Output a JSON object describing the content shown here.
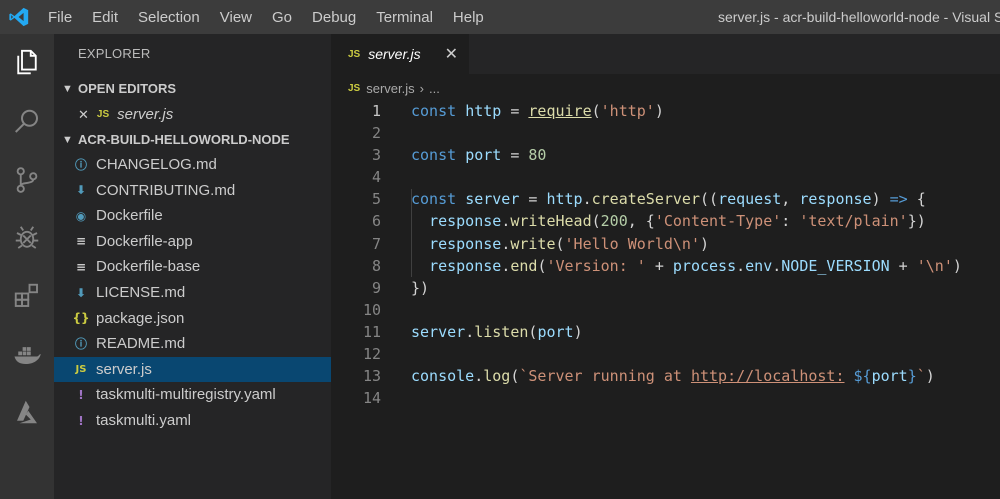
{
  "titlebar": {
    "menu": [
      "File",
      "Edit",
      "Selection",
      "View",
      "Go",
      "Debug",
      "Terminal",
      "Help"
    ],
    "window_title": "server.js - acr-build-helloworld-node - Visual S"
  },
  "activity_bar": {
    "icons": [
      "explorer-icon",
      "search-icon",
      "source-control-icon",
      "debug-icon",
      "extensions-icon",
      "docker-icon",
      "azure-icon"
    ]
  },
  "sidebar": {
    "title": "EXPLORER",
    "open_editors": {
      "label": "OPEN EDITORS",
      "items": [
        {
          "close": "✕",
          "type_badge": "JS",
          "name": "server.js"
        }
      ]
    },
    "project": {
      "label": "ACR-BUILD-HELLOWORLD-NODE",
      "files": [
        {
          "icon": "info-icon",
          "glyph": "ⓘ",
          "name": "CHANGELOG.md"
        },
        {
          "icon": "markdown-icon",
          "glyph": "⬇",
          "name": "CONTRIBUTING.md"
        },
        {
          "icon": "docker-file-icon",
          "glyph": "◉",
          "name": "Dockerfile"
        },
        {
          "icon": "text-file-icon",
          "glyph": "≡",
          "name": "Dockerfile-app"
        },
        {
          "icon": "text-file-icon",
          "glyph": "≡",
          "name": "Dockerfile-base"
        },
        {
          "icon": "markdown-icon",
          "glyph": "⬇",
          "name": "LICENSE.md"
        },
        {
          "icon": "json-icon",
          "glyph": "{}",
          "name": "package.json"
        },
        {
          "icon": "info-icon",
          "glyph": "ⓘ",
          "name": "README.md"
        },
        {
          "icon": "javascript-icon",
          "glyph": "JS",
          "name": "server.js"
        },
        {
          "icon": "yaml-icon",
          "glyph": "!",
          "name": "taskmulti-multiregistry.yaml"
        },
        {
          "icon": "yaml-icon",
          "glyph": "!",
          "name": "taskmulti.yaml"
        }
      ],
      "selected": "server.js"
    }
  },
  "editor": {
    "tab": {
      "type_badge": "JS",
      "label": "server.js",
      "close": "✕"
    },
    "breadcrumb": {
      "type_badge": "JS",
      "file": "server.js",
      "separator": "›",
      "more": "..."
    },
    "active_line": 1,
    "lines": [
      [
        {
          "t": "const",
          "c": "k"
        },
        {
          "t": " "
        },
        {
          "t": "http",
          "c": "v"
        },
        {
          "t": " = "
        },
        {
          "t": "require",
          "c": "f u"
        },
        {
          "t": "("
        },
        {
          "t": "'http'",
          "c": "s"
        },
        {
          "t": ")"
        }
      ],
      [],
      [
        {
          "t": "const",
          "c": "k"
        },
        {
          "t": " "
        },
        {
          "t": "port",
          "c": "v"
        },
        {
          "t": " = "
        },
        {
          "t": "80",
          "c": "n"
        }
      ],
      [],
      [
        {
          "t": "const",
          "c": "k"
        },
        {
          "t": " "
        },
        {
          "t": "server",
          "c": "v"
        },
        {
          "t": " = "
        },
        {
          "t": "http",
          "c": "v"
        },
        {
          "t": "."
        },
        {
          "t": "createServer",
          "c": "f"
        },
        {
          "t": "(("
        },
        {
          "t": "request",
          "c": "v"
        },
        {
          "t": ", "
        },
        {
          "t": "response",
          "c": "v"
        },
        {
          "t": ") "
        },
        {
          "t": "=>",
          "c": "k"
        },
        {
          "t": " {"
        }
      ],
      [
        {
          "t": "  "
        },
        {
          "t": "response",
          "c": "v"
        },
        {
          "t": "."
        },
        {
          "t": "writeHead",
          "c": "f"
        },
        {
          "t": "("
        },
        {
          "t": "200",
          "c": "n"
        },
        {
          "t": ", {"
        },
        {
          "t": "'Content-Type'",
          "c": "s"
        },
        {
          "t": ": "
        },
        {
          "t": "'text/plain'",
          "c": "s"
        },
        {
          "t": "})"
        }
      ],
      [
        {
          "t": "  "
        },
        {
          "t": "response",
          "c": "v"
        },
        {
          "t": "."
        },
        {
          "t": "write",
          "c": "f"
        },
        {
          "t": "("
        },
        {
          "t": "'Hello World\\n'",
          "c": "s"
        },
        {
          "t": ")"
        }
      ],
      [
        {
          "t": "  "
        },
        {
          "t": "response",
          "c": "v"
        },
        {
          "t": "."
        },
        {
          "t": "end",
          "c": "f"
        },
        {
          "t": "("
        },
        {
          "t": "'Version: '",
          "c": "s"
        },
        {
          "t": " + "
        },
        {
          "t": "process",
          "c": "v"
        },
        {
          "t": "."
        },
        {
          "t": "env",
          "c": "v"
        },
        {
          "t": "."
        },
        {
          "t": "NODE_VERSION",
          "c": "v"
        },
        {
          "t": " + "
        },
        {
          "t": "'\\n'",
          "c": "s"
        },
        {
          "t": ")"
        }
      ],
      [
        {
          "t": "})"
        }
      ],
      [],
      [
        {
          "t": "server",
          "c": "v"
        },
        {
          "t": "."
        },
        {
          "t": "listen",
          "c": "f"
        },
        {
          "t": "("
        },
        {
          "t": "port",
          "c": "v"
        },
        {
          "t": ")"
        }
      ],
      [],
      [
        {
          "t": "console",
          "c": "v"
        },
        {
          "t": "."
        },
        {
          "t": "log",
          "c": "f"
        },
        {
          "t": "("
        },
        {
          "t": "`Server running at ",
          "c": "s"
        },
        {
          "t": "http://localhost:",
          "c": "s u"
        },
        {
          "t": " ",
          "c": "s"
        },
        {
          "t": "${",
          "c": "k"
        },
        {
          "t": "port",
          "c": "v"
        },
        {
          "t": "}",
          "c": "k"
        },
        {
          "t": "`",
          "c": "s"
        },
        {
          "t": ")"
        }
      ],
      []
    ]
  },
  "colors": {
    "titlebar_bg": "#3c3c3c",
    "activity_bg": "#333333",
    "sidebar_bg": "#252526",
    "editor_bg": "#1e1e1e",
    "selection_bg": "#094771",
    "vscode_blue": "#23a9f2"
  }
}
